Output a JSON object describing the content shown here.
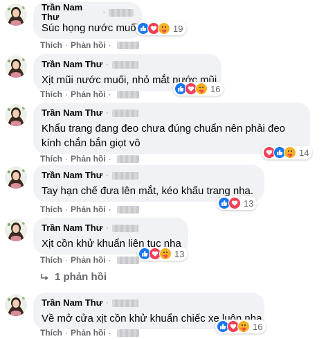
{
  "comments": [
    {
      "author": "Trần Nam Thư",
      "text_lines": [
        "Súc họng nước muối"
      ],
      "reaction_count": "19",
      "reactions": [
        "like",
        "love",
        "care"
      ]
    },
    {
      "author": "Trần Nam Thư",
      "text_lines": [
        "Xịt mũi nước muối, nhỏ mắt nước mũi"
      ],
      "reaction_count": "16",
      "reactions": [
        "like",
        "love",
        "care"
      ]
    },
    {
      "author": "Trần Nam Thư",
      "text_lines": [
        "Khẩu trang đang đeo chưa đúng chuẩn nên phải đeo",
        "kính chắn bắn giọt vô"
      ],
      "reaction_count": "14",
      "reactions": [
        "love",
        "like",
        "care"
      ]
    },
    {
      "author": "Trần Nam Thư",
      "text_lines": [
        "Tay hạn chế đưa lên mắt, kéo khẩu trang nha."
      ],
      "reaction_count": "13",
      "reactions": [
        "like",
        "love"
      ]
    },
    {
      "author": "Trần Nam Thư",
      "text_lines": [
        "Xịt cồn khử khuẩn liên tục nha"
      ],
      "reaction_count": "13",
      "reactions": [
        "like",
        "love",
        "care"
      ]
    },
    {
      "author": "Trần Nam Thư",
      "text_lines": [
        "Về mở cửa xịt cồn khử khuẩn chiếc xe luôn nha"
      ],
      "reaction_count": "16",
      "reactions": [
        "like",
        "love",
        "care"
      ]
    }
  ],
  "actions": {
    "like_label": "Thích",
    "reply_label": "Phản hồi",
    "separator": "·"
  },
  "replies_link": {
    "label": "1 phản hồi",
    "icon": "reply-arrow-icon"
  },
  "colors": {
    "bubble": "#f0f2f5",
    "like": "#1877f2",
    "love": "#f33e58",
    "care": "#f7b125",
    "meta_text": "#65676b"
  }
}
